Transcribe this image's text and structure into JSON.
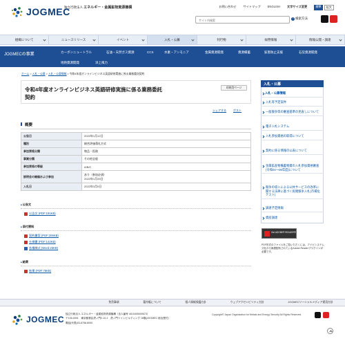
{
  "header": {
    "logo_text": "JOGMEC",
    "org_line1": "独立行政法人",
    "org_line1b": "エネルギー・金属鉱物資源機構",
    "top_links": [
      "お問い合わせ",
      "サイトマップ",
      "ENGLISH",
      "文字サイズ変更"
    ],
    "size_options": [
      "標準",
      "拡大"
    ],
    "search_placeholder": "サイト内検索",
    "search_label": "検索方法"
  },
  "nav": {
    "items": [
      "組織について",
      "ニュースリリース",
      "イベント",
      "入札・公募",
      "刊行物",
      "採用情報",
      "情報公開・調達"
    ]
  },
  "subbar": {
    "title": "JOGMECの事業",
    "row1": [
      "カーボンニュートラル",
      "石油・天然ガス資源",
      "CCS",
      "水素・アンモニア",
      "金属資源開発",
      "資源備蓄",
      "鉱害防止支援",
      "石炭資源開発"
    ],
    "row2": [
      "地熱資源開発",
      "洋上風力"
    ]
  },
  "breadcrumb": [
    "ホーム",
    "入札・公募",
    "入札・公募情報",
    "令和4年度オンラインビジネス英語研修実施に係る業務委託契約"
  ],
  "page": {
    "title_line1": "令和4年度オンラインビジネス英語研修実施に係る業務委託",
    "title_line2": "契約",
    "print_label": "印刷用ページ",
    "share": [
      "シェアする",
      "ポスト"
    ]
  },
  "overview": {
    "heading": "概要",
    "rows": [
      {
        "k": "公告日",
        "v": "2022年1月12日"
      },
      {
        "k": "種別",
        "v": "総合評価落札方式"
      },
      {
        "k": "参加資格分類",
        "v": "物品・役務"
      },
      {
        "k": "事業分類",
        "v": "その他全般"
      },
      {
        "k": "参加資格の等級",
        "v": "A/B/C"
      },
      {
        "k": "説明会の開催および参加",
        "v": "あり（参加必須）\n2022年1月25日"
      },
      {
        "k": "入札日",
        "v": "2022年3月9日"
      }
    ]
  },
  "sections": {
    "notice": {
      "heading": "公告文",
      "files": [
        "公告文 (PDF:191KB)"
      ]
    },
    "attachments": {
      "heading": "添付資料",
      "files": [
        "契約書案 (PDF:206KB)",
        "仕様書 (PDF:142KB)",
        "各種様式 (Word:25KB)"
      ]
    },
    "result": {
      "heading": "結果",
      "files": [
        "結果 (PDF:78KB)"
      ]
    }
  },
  "sidebar": {
    "heading": "入札・公募",
    "items": [
      "入札・公募情報",
      "入札等予定案件",
      "一般競争等の審査基準の見直しについて",
      "電子入札システム",
      "入札参加資格の取得について",
      "契約に係る情報の公表について",
      "金属鉱産物備蓄物資の入札参加資格審査(令和04～06年度)について",
      "競争の導入による公共サービスの改革に関する法律に基づく民間競争入札(市場化テスト)",
      "調達予定情報",
      "資産調達"
    ]
  },
  "adobe": {
    "badge": "Get ADOBE® READER®",
    "note": "PDF形式のファイルをご覧いただくには、アドビシステムズ社から無償配布されているAdobe Readerプラグインが必要です。"
  },
  "footer": {
    "links": [
      "免責事項",
      "著作権について",
      "個人情報保護方針",
      "ウェブアクセシビリティ方針",
      "JOGMECソーシャルメディア運用方針"
    ],
    "org_line1": "独立行政法人 エネルギー・金属鉱物資源機構（法人番号 4010405009573）",
    "org_line2": "〒105-0001　東京都港区虎ノ門2-10-1　虎ノ門ツインビルディング 16階(JOGMEC 総合受付)",
    "org_line3": "電話(代表)03-6758-8000",
    "copyright": "Copyright© Japan Organization for Metals and Energy Security All Rights Reserved."
  },
  "colors": {
    "brand": "#1e4f94",
    "link": "#0a57a6"
  }
}
